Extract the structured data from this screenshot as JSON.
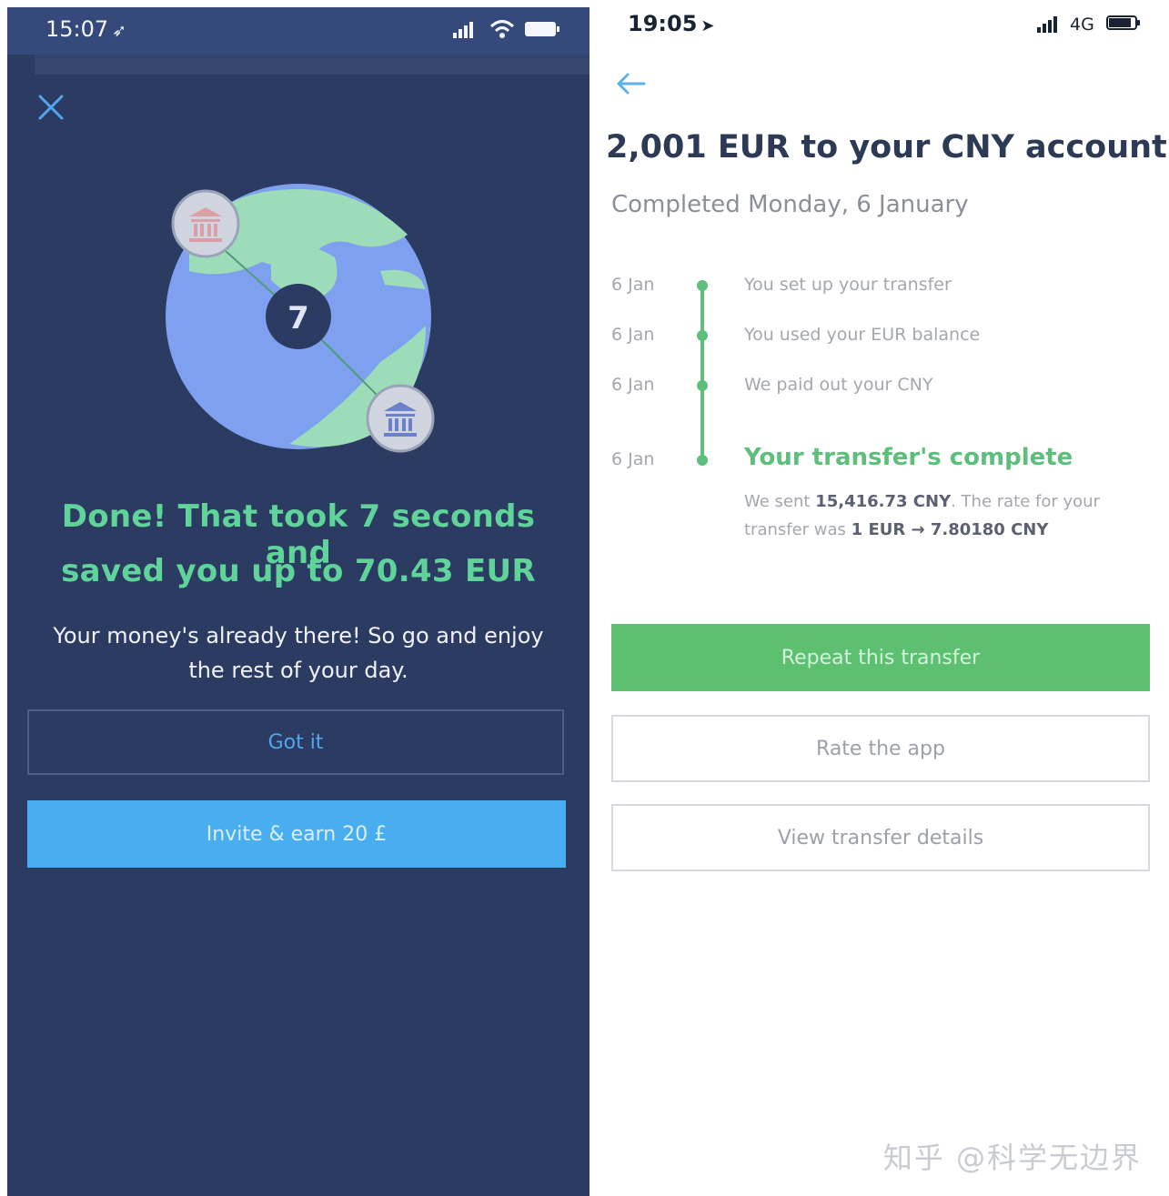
{
  "left": {
    "status_time": "15:07",
    "status_arrow": "➶",
    "logo_glyph": "7",
    "headline_line1": "Done! That took 7 seconds and",
    "headline_line2": "saved you up to 70.43 EUR",
    "body_line1": "Your money's already there! So go and enjoy",
    "body_line2": "the rest of your day.",
    "got_it_label": "Got it",
    "invite_label": "Invite & earn 20 £",
    "colors": {
      "background": "#2c3b61",
      "accent_green": "#5fd39a",
      "accent_blue": "#49aef0"
    }
  },
  "right": {
    "status_time": "19:05",
    "status_arrow": "➤",
    "network_label": "4G",
    "title": "2,001 EUR to your CNY account",
    "subtitle": "Completed Monday, 6 January",
    "timeline": [
      {
        "date": "6 Jan",
        "text": "You set up your transfer"
      },
      {
        "date": "6 Jan",
        "text": "You used your EUR balance"
      },
      {
        "date": "6 Jan",
        "text": "We paid out your CNY"
      },
      {
        "date": "6 Jan",
        "text": "Your transfer's complete"
      }
    ],
    "complete_desc": {
      "sent_prefix": "We sent ",
      "sent_amount": "15,416.73 CNY",
      "rate_prefix": ". The rate for your transfer was ",
      "rate_value": "1 EUR → 7.80180 CNY"
    },
    "repeat_label": "Repeat this transfer",
    "rate_label": "Rate the app",
    "details_label": "View transfer details",
    "watermark": "知乎 @科学无边界",
    "colors": {
      "accent_green": "#5cc070",
      "title": "#2c3a55"
    }
  }
}
